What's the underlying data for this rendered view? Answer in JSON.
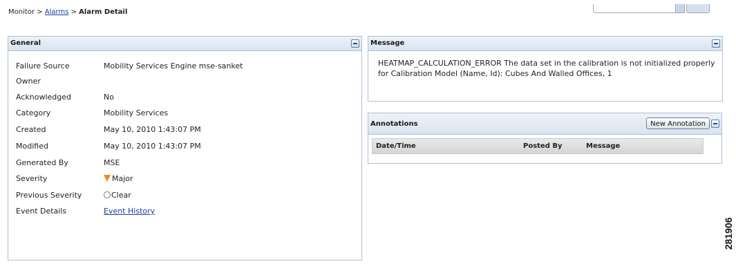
{
  "breadcrumb": {
    "root": "Monitor",
    "sep1": " > ",
    "alarms": "Alarms",
    "sep2": " > ",
    "current": "Alarm Detail"
  },
  "general": {
    "title": "General",
    "rows": [
      {
        "label": "Failure Source",
        "value": "Mobility Services Engine mse-sanket"
      },
      {
        "label": "Owner",
        "value": ""
      },
      {
        "label": "Acknowledged",
        "value": "No"
      },
      {
        "label": "Category",
        "value": "Mobility Services"
      },
      {
        "label": "Created",
        "value": "May 10, 2010 1:43:07 PM"
      },
      {
        "label": "Modified",
        "value": "May 10, 2010 1:43:07 PM"
      },
      {
        "label": "Generated By",
        "value": "MSE"
      },
      {
        "label": "Severity",
        "value": "Major"
      },
      {
        "label": "Previous Severity",
        "value": "Clear"
      },
      {
        "label": "Event Details",
        "value": "Event History"
      }
    ]
  },
  "message": {
    "title": "Message",
    "text": "HEATMAP_CALCULATION_ERROR The data set in the calibration is not initialized properly for Calibration Model (Name, Id): Cubes And Walled Offices, 1"
  },
  "annotations": {
    "title": "Annotations",
    "new_button": "New Annotation",
    "columns": [
      "Date/Time",
      "Posted By",
      "Message"
    ]
  },
  "figure_number": "281906",
  "colors": {
    "major": "#f08a1c",
    "link": "#1a3d9c",
    "panel_border": "#aebfd6"
  }
}
